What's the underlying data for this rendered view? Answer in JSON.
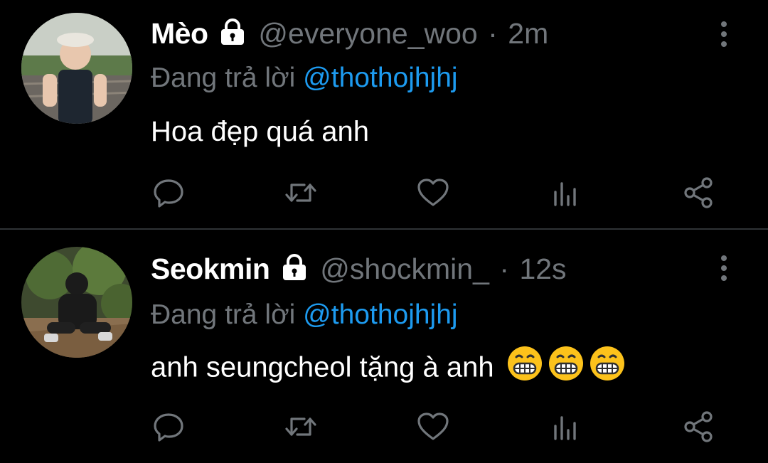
{
  "tweets": [
    {
      "name": "Mèo",
      "handle": "@everyone_woo",
      "separator": "·",
      "time": "2m",
      "replying_prefix": "Đang trả lời",
      "replying_to": "@thothojhjhj",
      "text": "Hoa đẹp quá anh",
      "emojis": [],
      "icons": {
        "lock": "lock-icon",
        "more": "more-vertical-icon"
      }
    },
    {
      "name": "Seokmin",
      "handle": "@shockmin_",
      "separator": "·",
      "time": "12s",
      "replying_prefix": "Đang trả lời",
      "replying_to": "@thothojhjhj",
      "text": "anh seungcheol tặng à anh",
      "emojis": [
        "grinning-face-emoji",
        "grinning-face-emoji",
        "grinning-face-emoji"
      ],
      "icons": {
        "lock": "lock-icon",
        "more": "more-vertical-icon"
      }
    }
  ],
  "action_icons": [
    "reply-icon",
    "retweet-icon",
    "like-icon",
    "analytics-icon",
    "share-icon"
  ],
  "colors": {
    "background": "#000000",
    "name": "#ffffff",
    "muted": "#71767b",
    "mention": "#1d9bf0",
    "divider": "#2f3336"
  }
}
